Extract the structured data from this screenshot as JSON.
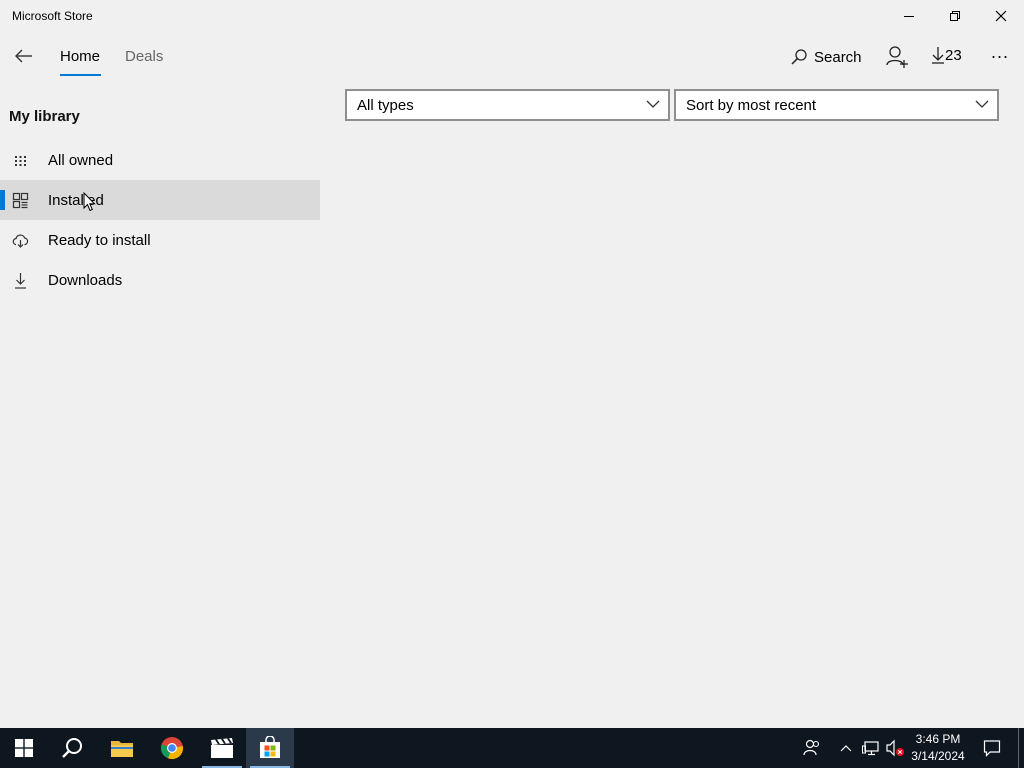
{
  "window": {
    "title": "Microsoft Store"
  },
  "nav": {
    "tabs": [
      {
        "label": "Home"
      },
      {
        "label": "Deals"
      }
    ],
    "search_label": "Search",
    "downloads_count": "23",
    "more_label": "..."
  },
  "sidebar": {
    "heading": "My library",
    "items": [
      {
        "label": "All owned",
        "icon": "grid-icon"
      },
      {
        "label": "Installed",
        "icon": "installed-icon",
        "selected": true
      },
      {
        "label": "Ready to install",
        "icon": "cloud-download-icon"
      },
      {
        "label": "Downloads",
        "icon": "download-icon"
      }
    ]
  },
  "filters": {
    "type_filter": "All types",
    "sort_filter": "Sort by most recent"
  },
  "taskbar": {
    "time": "3:46 PM",
    "date": "3/14/2024",
    "active_app": "Microsoft Store"
  },
  "colors": {
    "accent": "#0078d7",
    "taskbar": "#0e1620",
    "background": "#f0f0f0"
  }
}
